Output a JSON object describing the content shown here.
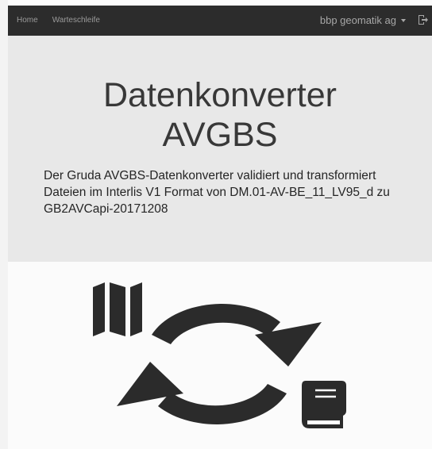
{
  "navbar": {
    "links": [
      "Home",
      "Warteschleife"
    ],
    "user": "bbp geomatik ag",
    "logout_icon": "sign-out-icon"
  },
  "hero": {
    "title_line1": "Datenkonverter",
    "title_line2": "AVGBS",
    "description": "Der Gruda AVGBS-Datenkonverter validiert und transformiert Dateien im Interlis V1 Format von DM.01-AV-BE_11_LV95_d zu GB2AVCapi-20171208"
  },
  "illustration": {
    "icons": [
      "map-icon",
      "sync-arrows-icon",
      "book-icon"
    ],
    "color": "#2b2b2b"
  },
  "colors": {
    "navbar_bg": "#2c2c2c",
    "hero_bg": "#e8e8e8",
    "page_bg": "#fbfbfb"
  }
}
